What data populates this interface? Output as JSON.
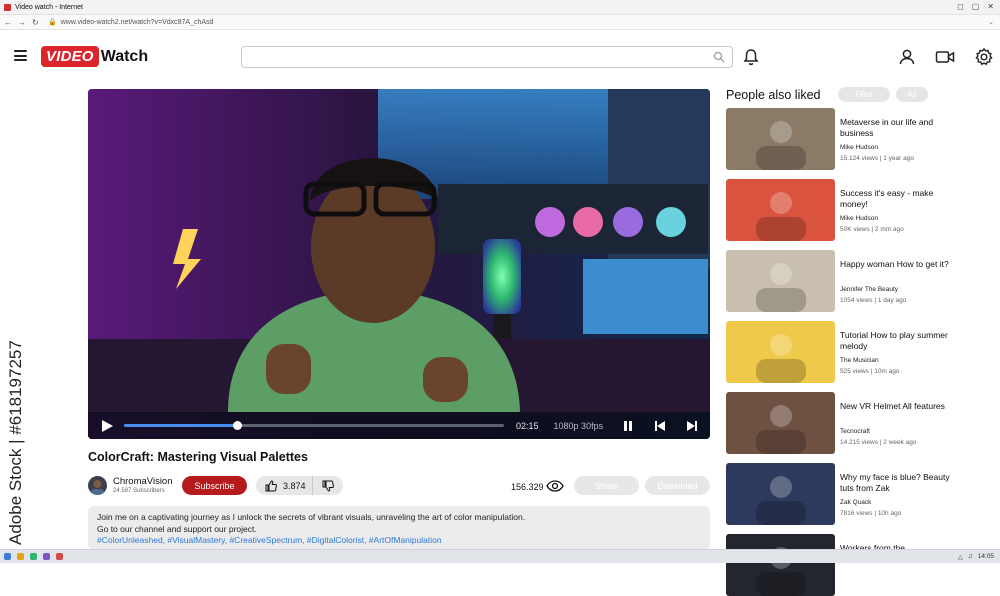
{
  "browser": {
    "tab_title": "Video watch - Internet",
    "url": "www.video-watch2.net/watch?v=Vdxc87A_chAsd"
  },
  "header": {
    "logo_part1": "VIDEO",
    "logo_part2": "Watch",
    "search_placeholder": "",
    "brand_color": "#d9252b"
  },
  "player": {
    "time": "02:15",
    "quality": "1080p 30fps",
    "progress_fraction": 0.298
  },
  "video": {
    "title": "ColorCraft: Mastering Visual Palettes",
    "channel_name": "ChromaVision",
    "channel_subs": "24.597 Subscribers",
    "subscribe_label": "Subscribe",
    "likes": "3.874",
    "views": "156.329",
    "share_label": "Share",
    "download_label": "Download",
    "description_line1": "Join me on a captivating journey as I unlock the secrets of vibrant visuals, unraveling the art of color manipulation.",
    "description_line2": "Go to our channel and support our project.",
    "hashtags": "#ColorUnleashed, #VisualMastery, #CreativeSpectrum, #DigitalColorist, #ArtOfManipulation"
  },
  "sidebar": {
    "title": "People also liked",
    "filter_label": "Filter",
    "all_label": "All",
    "items": [
      {
        "title": "Metaverse in our life and business",
        "author": "Mike Hudson",
        "meta": "15.124 views  |  1 year ago",
        "thumb_color": "#8a7a66"
      },
      {
        "title": "Success it's easy - make money!",
        "author": "Mike Hudson",
        "meta": "50K views  |  2 mm ago",
        "thumb_color": "#d9533e"
      },
      {
        "title": "Happy woman How to get it?",
        "author": "Jennifer The Beauty",
        "meta": "1054 views  |  1 day ago",
        "thumb_color": "#c8bfae"
      },
      {
        "title": "Tutorial How to play summer melody",
        "author": "The Musician",
        "meta": "525 views  |  10m ago",
        "thumb_color": "#efc94a"
      },
      {
        "title": "New VR Helmet All features",
        "author": "Tecnocraft",
        "meta": "14.215 views  |  2 week ago",
        "thumb_color": "#6f5142"
      },
      {
        "title": "Why my face is blue? Beauty tuts from Zak",
        "author": "Zak Quack",
        "meta": "7816 views  |  10h ago",
        "thumb_color": "#2d3a5e"
      },
      {
        "title": "Workers from the",
        "author": "",
        "meta": "",
        "thumb_color": "#23262e"
      }
    ]
  },
  "watermark": "Adobe Stock | #618197257",
  "taskbar": {
    "time": "14:05"
  }
}
